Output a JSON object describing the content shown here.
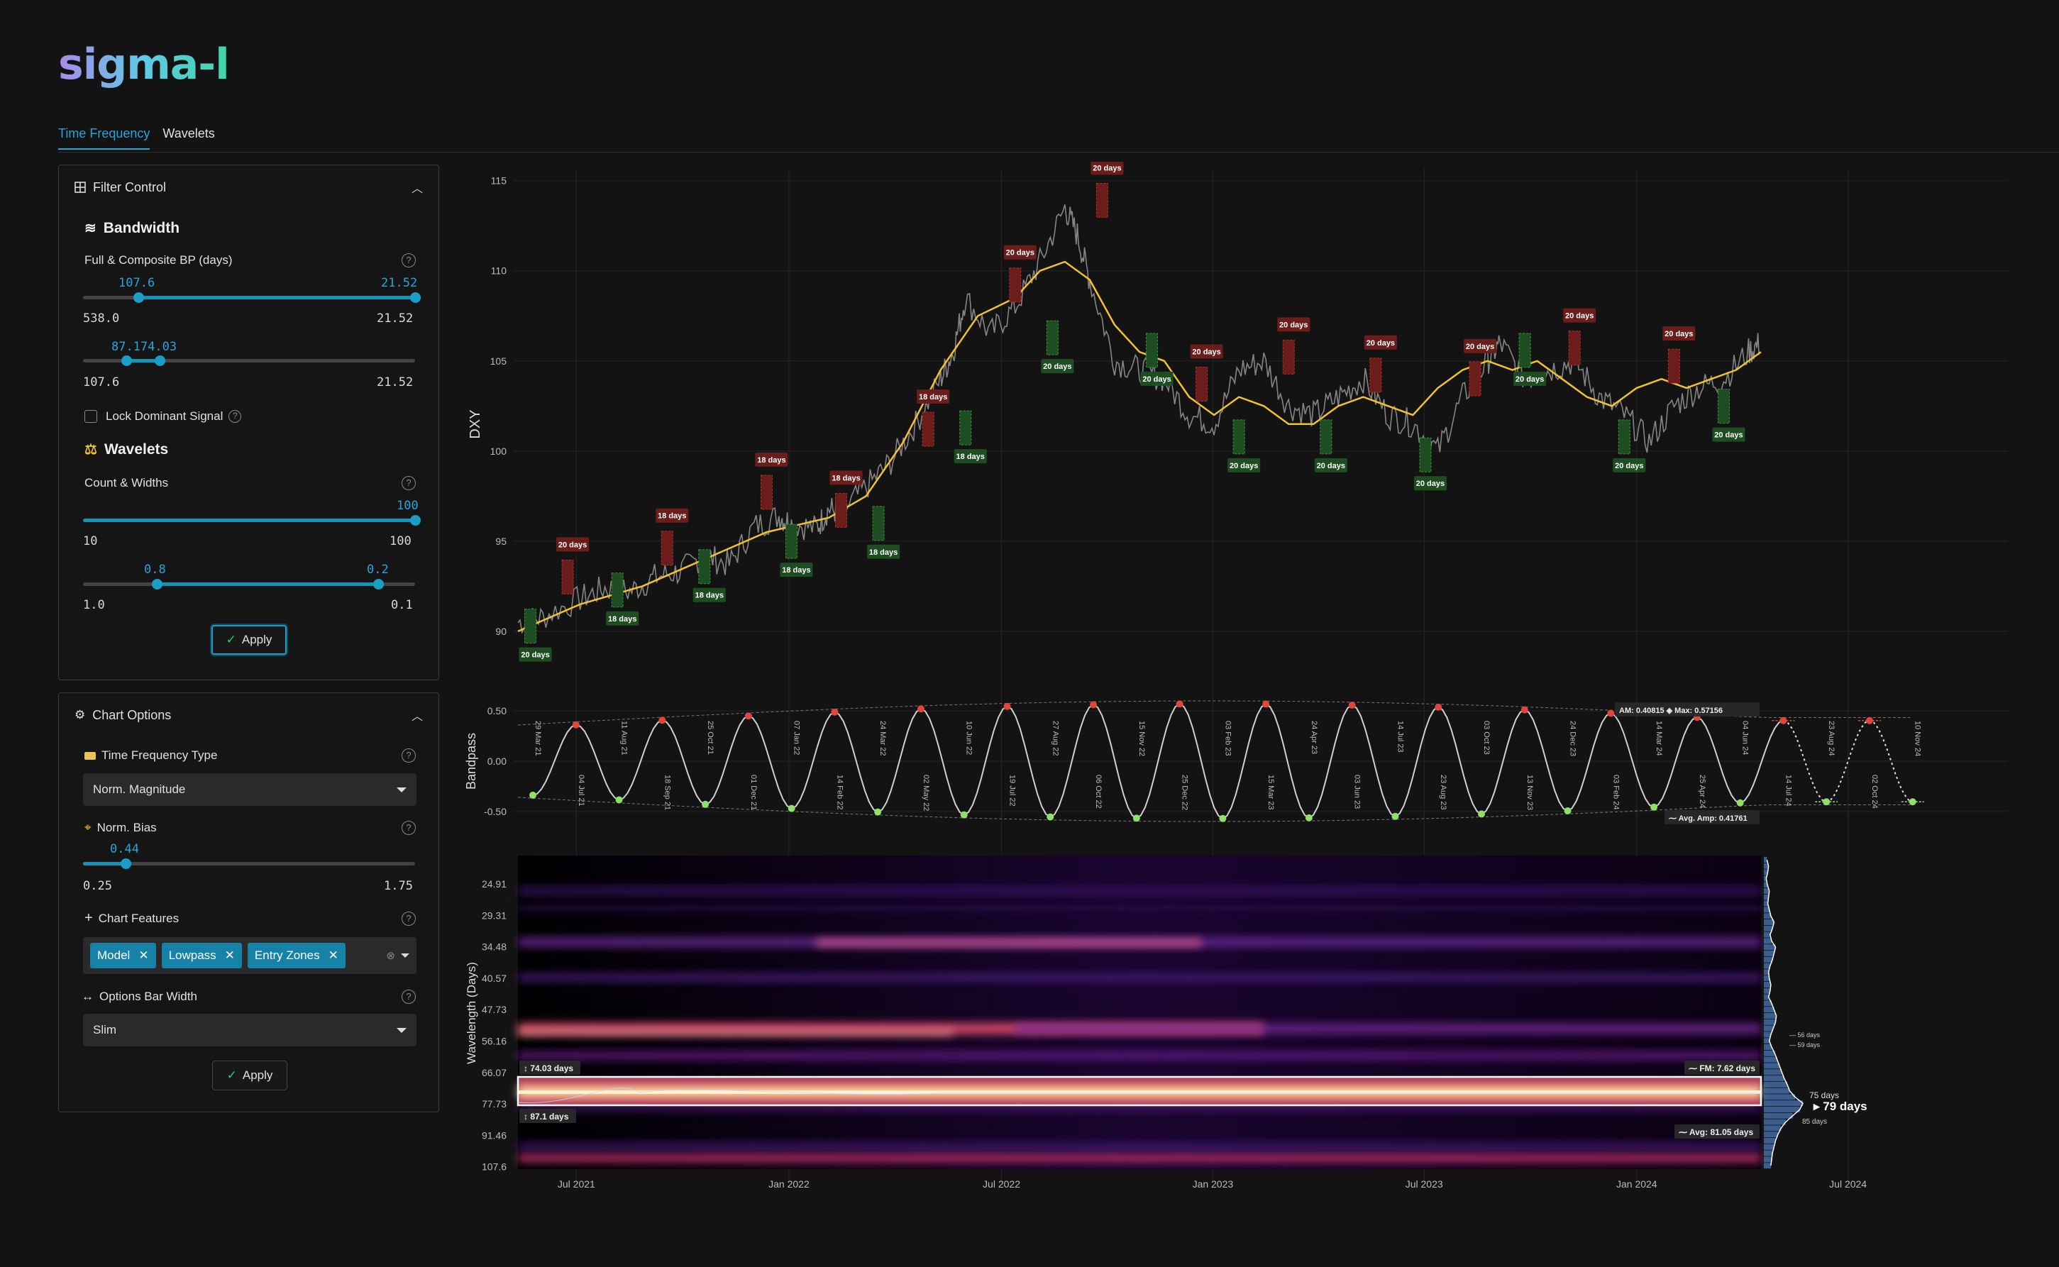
{
  "app": {
    "logo": "sigma-l"
  },
  "tabs": [
    {
      "label": "Time Frequency",
      "active": true
    },
    {
      "label": "Wavelets",
      "active": false
    }
  ],
  "filter_control": {
    "title": "Filter Control",
    "bandwidth_title": "Bandwidth",
    "bp_label": "Full & Composite BP (days)",
    "slider1": {
      "low": "107.6",
      "high": "21.52",
      "min": "538.0",
      "max": "21.52"
    },
    "slider2": {
      "low": "87.1",
      "high": "74.03",
      "combined": "87.174.03",
      "min": "107.6",
      "max": "21.52"
    },
    "lock_label": "Lock Dominant Signal",
    "wavelets_title": "Wavelets",
    "count_label": "Count & Widths",
    "slider3": {
      "value": "100",
      "min": "10",
      "max": "100"
    },
    "slider4": {
      "low": "0.8",
      "high": "0.2",
      "min": "1.0",
      "max": "0.1"
    },
    "apply_label": "Apply"
  },
  "chart_options": {
    "title": "Chart Options",
    "tf_type_label": "Time Frequency Type",
    "tf_type_value": "Norm. Magnitude",
    "norm_bias_label": "Norm. Bias",
    "norm_bias": {
      "value": "0.44",
      "min": "0.25",
      "max": "1.75"
    },
    "features_label": "Chart Features",
    "features": [
      "Model",
      "Lowpass",
      "Entry Zones"
    ],
    "bar_width_label": "Options Bar Width",
    "bar_width_value": "Slim",
    "apply_label": "Apply"
  },
  "colors": {
    "accent": "#1a9ec6",
    "lowpass": "#f2c12e",
    "peak": "#e0463a",
    "trough": "#8ee06a",
    "red_box": "#6a1d1a",
    "green_box": "#1f4d22"
  },
  "chart_data": [
    {
      "type": "line",
      "ylabel": "DXY",
      "yticks": [
        90,
        95,
        100,
        105,
        110,
        115
      ],
      "ylim": [
        88.5,
        115.5
      ],
      "price": [
        [
          0,
          90.5
        ],
        [
          0.02,
          90.8
        ],
        [
          0.05,
          91.8
        ],
        [
          0.07,
          92.4
        ],
        [
          0.09,
          92.2
        ],
        [
          0.11,
          93.0
        ],
        [
          0.13,
          93.3
        ],
        [
          0.15,
          94.2
        ],
        [
          0.17,
          93.7
        ],
        [
          0.19,
          95.8
        ],
        [
          0.21,
          96.4
        ],
        [
          0.22,
          96.0
        ],
        [
          0.24,
          95.7
        ],
        [
          0.25,
          96.8
        ],
        [
          0.26,
          96.6
        ],
        [
          0.28,
          98.0
        ],
        [
          0.3,
          99.4
        ],
        [
          0.32,
          101.5
        ],
        [
          0.34,
          104.0
        ],
        [
          0.35,
          105.5
        ],
        [
          0.36,
          108.5
        ],
        [
          0.38,
          106.5
        ],
        [
          0.4,
          108.0
        ],
        [
          0.42,
          110.5
        ],
        [
          0.44,
          113.5
        ],
        [
          0.45,
          112.0
        ],
        [
          0.46,
          109.5
        ],
        [
          0.48,
          105.0
        ],
        [
          0.5,
          104.5
        ],
        [
          0.52,
          104.0
        ],
        [
          0.54,
          102.0
        ],
        [
          0.56,
          101.5
        ],
        [
          0.58,
          104.5
        ],
        [
          0.6,
          105.0
        ],
        [
          0.62,
          102.5
        ],
        [
          0.64,
          102.0
        ],
        [
          0.66,
          103.0
        ],
        [
          0.68,
          104.0
        ],
        [
          0.7,
          102.0
        ],
        [
          0.72,
          101.5
        ],
        [
          0.74,
          100.0
        ],
        [
          0.76,
          103.0
        ],
        [
          0.78,
          105.0
        ],
        [
          0.79,
          106.0
        ],
        [
          0.81,
          104.0
        ],
        [
          0.83,
          104.5
        ],
        [
          0.85,
          105.0
        ],
        [
          0.87,
          103.0
        ],
        [
          0.89,
          102.0
        ],
        [
          0.91,
          100.5
        ],
        [
          0.93,
          102.5
        ],
        [
          0.95,
          103.5
        ],
        [
          0.97,
          104.0
        ],
        [
          0.99,
          105.5
        ],
        [
          1.0,
          106.0
        ]
      ],
      "lowpass": [
        [
          0,
          90.0
        ],
        [
          0.05,
          91.5
        ],
        [
          0.1,
          92.5
        ],
        [
          0.15,
          94.0
        ],
        [
          0.2,
          95.5
        ],
        [
          0.25,
          96.3
        ],
        [
          0.28,
          97.5
        ],
        [
          0.31,
          100.5
        ],
        [
          0.34,
          104.5
        ],
        [
          0.37,
          107.5
        ],
        [
          0.4,
          108.5
        ],
        [
          0.42,
          110.0
        ],
        [
          0.44,
          110.5
        ],
        [
          0.46,
          109.5
        ],
        [
          0.48,
          107.0
        ],
        [
          0.5,
          105.5
        ],
        [
          0.52,
          105.0
        ],
        [
          0.54,
          103.0
        ],
        [
          0.56,
          102.0
        ],
        [
          0.58,
          103.0
        ],
        [
          0.6,
          102.5
        ],
        [
          0.62,
          101.5
        ],
        [
          0.64,
          101.5
        ],
        [
          0.66,
          102.5
        ],
        [
          0.68,
          103.0
        ],
        [
          0.7,
          102.5
        ],
        [
          0.72,
          102.0
        ],
        [
          0.74,
          103.5
        ],
        [
          0.76,
          104.5
        ],
        [
          0.78,
          105.0
        ],
        [
          0.8,
          104.5
        ],
        [
          0.82,
          105.0
        ],
        [
          0.84,
          104.0
        ],
        [
          0.86,
          103.0
        ],
        [
          0.88,
          102.5
        ],
        [
          0.9,
          103.5
        ],
        [
          0.92,
          104.0
        ],
        [
          0.94,
          103.5
        ],
        [
          0.96,
          104.0
        ],
        [
          0.98,
          104.5
        ],
        [
          1.0,
          105.5
        ]
      ],
      "annotations": {
        "peaks": [
          {
            "x": 0.04,
            "y": 93.8,
            "label": "20 days"
          },
          {
            "x": 0.12,
            "y": 95.4,
            "label": "18 days"
          },
          {
            "x": 0.2,
            "y": 98.5,
            "label": "18 days"
          },
          {
            "x": 0.26,
            "y": 97.5,
            "label": "18 days"
          },
          {
            "x": 0.33,
            "y": 102.0,
            "label": "18 days"
          },
          {
            "x": 0.4,
            "y": 110.0,
            "label": "20 days"
          },
          {
            "x": 0.47,
            "y": 114.7,
            "label": "20 days"
          },
          {
            "x": 0.55,
            "y": 104.5,
            "label": "20 days"
          },
          {
            "x": 0.62,
            "y": 106.0,
            "label": "20 days"
          },
          {
            "x": 0.69,
            "y": 105.0,
            "label": "20 days"
          },
          {
            "x": 0.77,
            "y": 104.8,
            "label": "20 days"
          },
          {
            "x": 0.85,
            "y": 106.5,
            "label": "20 days"
          },
          {
            "x": 0.93,
            "y": 105.5,
            "label": "20 days"
          }
        ],
        "troughs": [
          {
            "x": 0.01,
            "y": 89.5,
            "label": "20 days"
          },
          {
            "x": 0.08,
            "y": 91.5,
            "label": "18 days"
          },
          {
            "x": 0.15,
            "y": 92.8,
            "label": "18 days"
          },
          {
            "x": 0.22,
            "y": 94.2,
            "label": "18 days"
          },
          {
            "x": 0.29,
            "y": 95.2,
            "label": "18 days"
          },
          {
            "x": 0.36,
            "y": 100.5,
            "label": "18 days"
          },
          {
            "x": 0.43,
            "y": 105.5,
            "label": "20 days"
          },
          {
            "x": 0.51,
            "y": 104.8,
            "label": "20 days"
          },
          {
            "x": 0.58,
            "y": 100.0,
            "label": "20 days"
          },
          {
            "x": 0.65,
            "y": 100.0,
            "label": "20 days"
          },
          {
            "x": 0.73,
            "y": 99.0,
            "label": "20 days"
          },
          {
            "x": 0.81,
            "y": 104.8,
            "label": "20 days"
          },
          {
            "x": 0.89,
            "y": 100.0,
            "label": "20 days"
          },
          {
            "x": 0.97,
            "y": 101.7,
            "label": "20 days"
          }
        ]
      }
    },
    {
      "type": "line",
      "ylabel": "Bandpass",
      "yticks": [
        "0.50",
        "0.00",
        "-0.50"
      ],
      "ylim": [
        -0.6,
        0.6
      ],
      "cycle_labels": [
        "29 Mar 21",
        "04 Jul 21",
        "11 Aug 21",
        "18 Sep 21",
        "25 Oct 21",
        "01 Dec 21",
        "07 Jan 22",
        "14 Feb 22",
        "24 Mar 22",
        "02 May 22",
        "10 Jun 22",
        "19 Jul 22",
        "27 Aug 22",
        "06 Oct 22",
        "15 Nov 22",
        "25 Dec 22",
        "03 Feb 23",
        "15 Mar 23",
        "24 Apr 23",
        "03 Jun 23",
        "14 Jul 23",
        "23 Aug 23",
        "03 Oct 23",
        "13 Nov 23",
        "24 Dec 23",
        "03 Feb 24",
        "14 Mar 24",
        "25 Apr 24",
        "04 Jun 24",
        "14 Jul 24",
        "23 Aug 24",
        "02 Oct 24",
        "10 Nov 24"
      ],
      "info": {
        "am": "AM: 0.40815",
        "max": "Max: 0.57156",
        "avg_amp": "Avg. Amp: 0.41761"
      }
    },
    {
      "type": "heatmap",
      "ylabel": "Wavelength (Days)",
      "yticks": [
        "24.91",
        "29.31",
        "34.48",
        "40.57",
        "47.73",
        "56.16",
        "66.07",
        "77.73",
        "91.46",
        "107.6"
      ],
      "xticks": [
        "Jul 2021",
        "Jan 2022",
        "Jul 2022",
        "Jan 2023",
        "Jul 2023",
        "Jan 2024",
        "Jul 2024"
      ],
      "band_labels": {
        "top": "74.03 days",
        "bottom": "87.1 days",
        "fm": "FM: 7.62 days",
        "avg": "Avg: 81.05 days"
      },
      "histogram_labels": {
        "d1": "56 days",
        "d2": "59 days",
        "d3": "75 days",
        "main": "79 days",
        "d4": "85 days"
      }
    }
  ]
}
